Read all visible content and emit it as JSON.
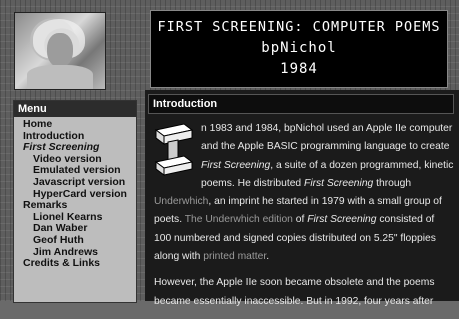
{
  "header": {
    "title": "FIRST SCREENING: COMPUTER POEMS",
    "author": "bpNichol",
    "year": "1984"
  },
  "menu": {
    "heading": "Menu",
    "items": [
      {
        "label": "Home",
        "level": 0,
        "current": false
      },
      {
        "label": "Introduction",
        "level": 0,
        "current": false
      },
      {
        "label": "First Screening",
        "level": 0,
        "current": true
      },
      {
        "label": "Video version",
        "level": 1,
        "current": false
      },
      {
        "label": "Emulated version",
        "level": 1,
        "current": false
      },
      {
        "label": "Javascript version",
        "level": 1,
        "current": false
      },
      {
        "label": "HyperCard version",
        "level": 1,
        "current": false
      },
      {
        "label": "Remarks",
        "level": 0,
        "current": false
      },
      {
        "label": "Lionel Kearns",
        "level": 1,
        "current": false
      },
      {
        "label": "Dan Waber",
        "level": 1,
        "current": false
      },
      {
        "label": "Geof Huth",
        "level": 1,
        "current": false
      },
      {
        "label": "Jim Andrews",
        "level": 1,
        "current": false
      },
      {
        "label": "Credits & Links",
        "level": 0,
        "current": false
      }
    ]
  },
  "intro": {
    "heading": "Introduction",
    "p1": {
      "t1": "n 1983 and 1984, bpNichol used an Apple IIe computer and the Apple BASIC programming language to create ",
      "e1": "First Screening",
      "t2": ", a suite of a dozen programmed, kinetic poems. He distributed ",
      "e2": "First Screening",
      "t3": " through ",
      "link1": "Underwhich",
      "t4": ", an imprint he started in 1979 with a small group of poets. ",
      "link2": "The Underwhich edition",
      "t5": " of ",
      "e3": "First Screening",
      "t6": " consisted of 100 numbered and signed copies distributed on 5.25\" floppies along with ",
      "link3": "printed matter",
      "t7": "."
    },
    "p2": "However, the Apple IIe soon became obsolete and the poems became essentially inaccessible. But in 1992, four years after"
  },
  "colors": {
    "panel_bg": "#1b1b1b",
    "menu_bg": "#bdbdbd",
    "link": "#9a9a9a"
  }
}
